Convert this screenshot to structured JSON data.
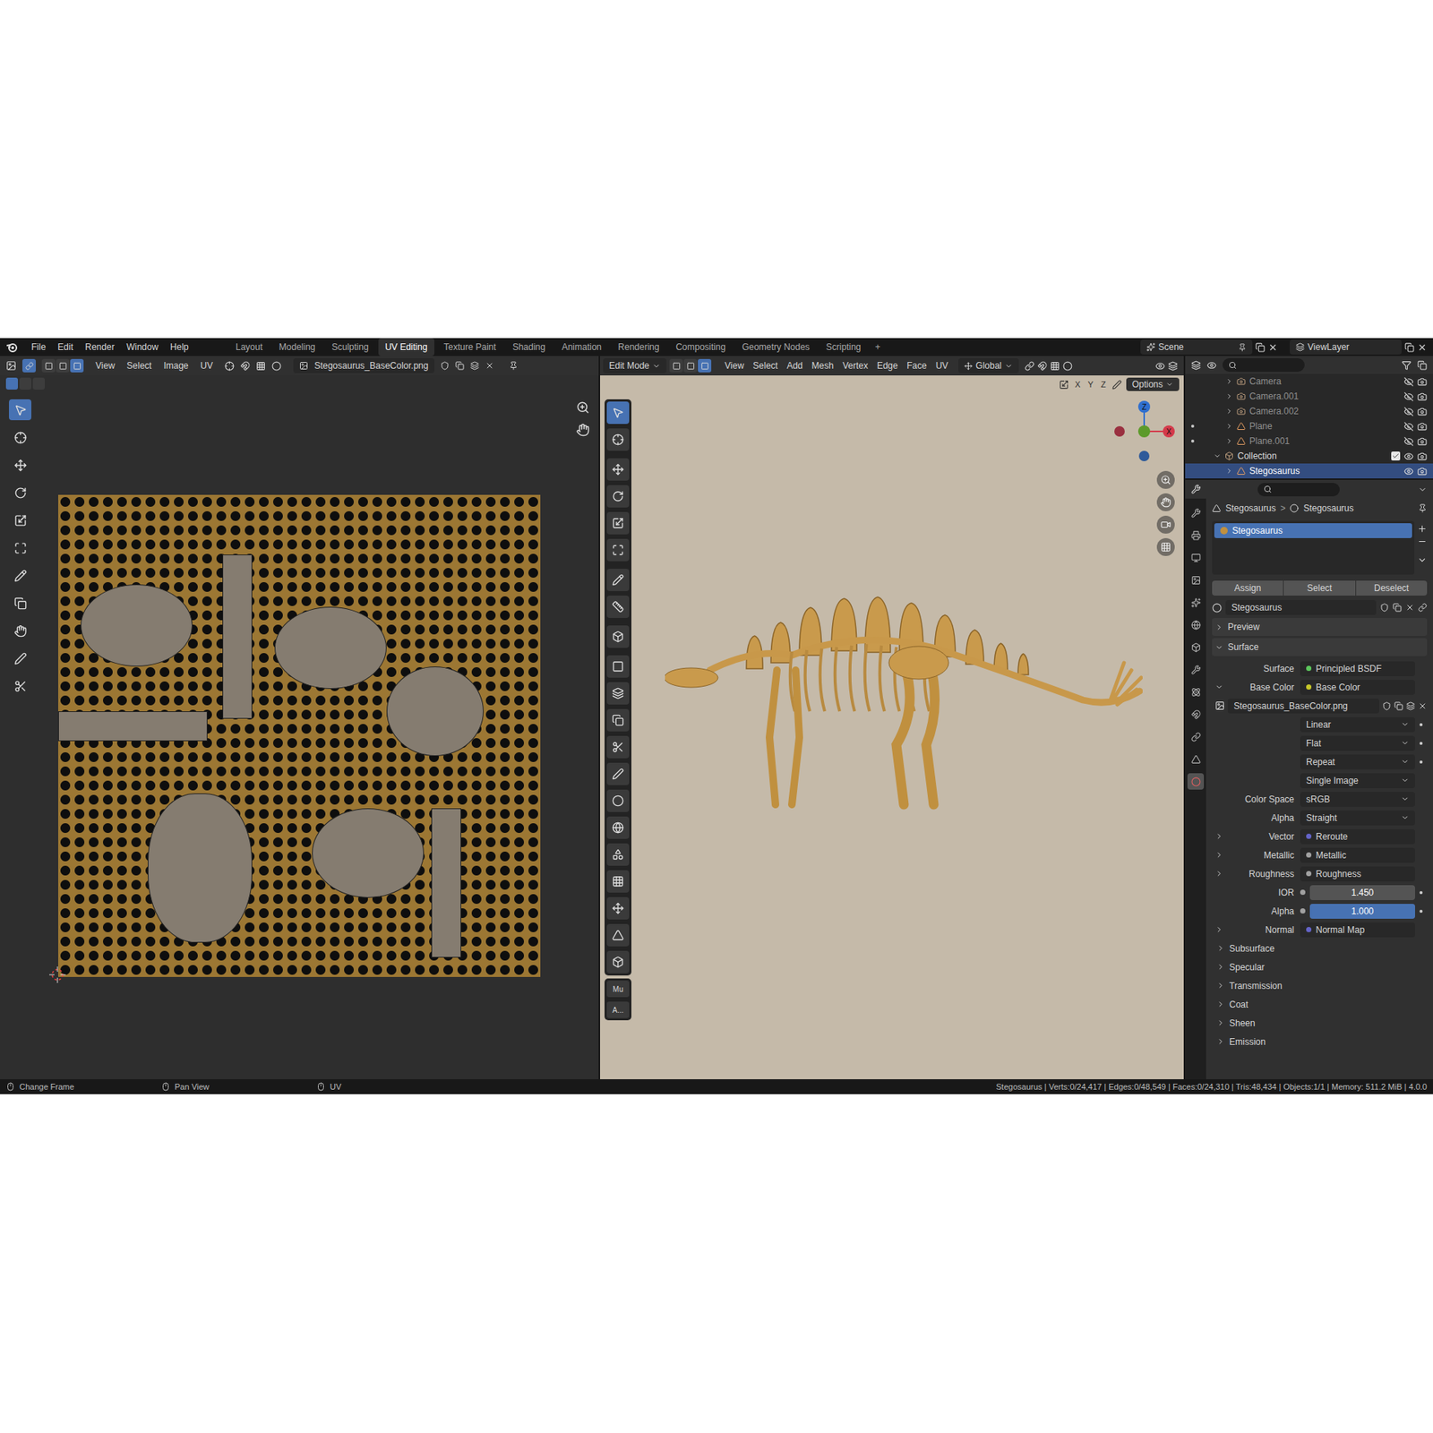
{
  "topbar": {
    "menus": [
      "File",
      "Edit",
      "Render",
      "Window",
      "Help"
    ],
    "workspaces": [
      {
        "label": "Layout",
        "selected": false
      },
      {
        "label": "Modeling",
        "selected": false
      },
      {
        "label": "Sculpting",
        "selected": false
      },
      {
        "label": "UV Editing",
        "selected": true
      },
      {
        "label": "Texture Paint",
        "selected": false
      },
      {
        "label": "Shading",
        "selected": false
      },
      {
        "label": "Animation",
        "selected": false
      },
      {
        "label": "Rendering",
        "selected": false
      },
      {
        "label": "Compositing",
        "selected": false
      },
      {
        "label": "Geometry Nodes",
        "selected": false
      },
      {
        "label": "Scripting",
        "selected": false
      }
    ],
    "add_tab": "+",
    "scene": "Scene",
    "view_layer": "ViewLayer"
  },
  "uv_editor": {
    "menus": [
      "View",
      "Select",
      "Image",
      "UV"
    ],
    "image_name": "Stegosaurus_BaseColor.png",
    "select_modes": [
      {
        "selected": false
      },
      {
        "selected": false
      },
      {
        "selected": true
      }
    ],
    "tools": [
      {
        "selected": true
      },
      {
        "selected": false
      },
      {
        "selected": false
      },
      {
        "selected": false
      },
      {
        "selected": false
      },
      {
        "selected": false
      },
      {
        "selected": false
      },
      {
        "selected": false
      },
      {
        "selected": false
      },
      {
        "selected": false
      },
      {
        "selected": false
      }
    ]
  },
  "viewport": {
    "mode": "Edit Mode",
    "menus": [
      "View",
      "Select",
      "Add",
      "Mesh",
      "Vertex",
      "Edge",
      "Face",
      "UV"
    ],
    "orientation": "Global",
    "select_modes": [
      {
        "selected": false
      },
      {
        "selected": false
      },
      {
        "selected": true
      }
    ],
    "axes": [
      "X",
      "Y",
      "Z"
    ],
    "options": "Options",
    "gizmo": {
      "z": "Z",
      "x": "X"
    },
    "tools": [
      {
        "selected": true
      },
      {
        "selected": false
      },
      {
        "selected": false
      },
      {
        "selected": false
      },
      {
        "selected": false
      },
      {
        "selected": false
      },
      {
        "selected": false
      },
      {
        "selected": false
      },
      {
        "selected": false
      },
      {
        "selected": false
      },
      {
        "selected": false
      },
      {
        "selected": false
      },
      {
        "selected": false
      },
      {
        "selected": false
      },
      {
        "selected": false
      },
      {
        "selected": false
      },
      {
        "selected": false
      },
      {
        "selected": false
      },
      {
        "selected": false
      },
      {
        "selected": false
      },
      {
        "selected": false
      }
    ],
    "side_tabs": [
      "Mu",
      "A..."
    ]
  },
  "outliner": {
    "items": [
      {
        "name": "Camera",
        "kind": "camera",
        "selected": false,
        "dimmed": true,
        "dot": false,
        "expanded": false,
        "visible": false
      },
      {
        "name": "Camera.001",
        "kind": "camera",
        "selected": false,
        "dimmed": true,
        "dot": false,
        "expanded": false,
        "visible": false
      },
      {
        "name": "Camera.002",
        "kind": "camera",
        "selected": false,
        "dimmed": true,
        "dot": false,
        "expanded": false,
        "visible": false
      },
      {
        "name": "Plane",
        "kind": "mesh",
        "selected": false,
        "dimmed": true,
        "dot": true,
        "expanded": false,
        "visible": false
      },
      {
        "name": "Plane.001",
        "kind": "mesh",
        "selected": false,
        "dimmed": true,
        "dot": true,
        "expanded": false,
        "visible": false
      },
      {
        "name": "Collection",
        "kind": "collection",
        "selected": false,
        "dimmed": false,
        "dot": false,
        "expanded": true,
        "visible": true
      },
      {
        "name": "Stegosaurus",
        "kind": "mesh",
        "selected": true,
        "dimmed": false,
        "dot": false,
        "expanded": false,
        "visible": true
      }
    ]
  },
  "properties": {
    "tabs": [
      {
        "selected": false
      },
      {
        "selected": false
      },
      {
        "selected": false
      },
      {
        "selected": false
      },
      {
        "selected": false
      },
      {
        "selected": false
      },
      {
        "selected": false
      },
      {
        "selected": false
      },
      {
        "selected": false
      },
      {
        "selected": false
      },
      {
        "selected": false
      },
      {
        "selected": false
      },
      {
        "selected": true
      }
    ],
    "breadcrumb": [
      "Stegosaurus",
      "Stegosaurus"
    ],
    "breadcrumb_separator": ">",
    "slots": [
      {
        "name": "Stegosaurus",
        "selected": true
      }
    ],
    "slot_buttons": [
      "Assign",
      "Select",
      "Deselect"
    ],
    "material": "Stegosaurus",
    "panels": [
      {
        "label": "Preview",
        "expanded": false
      },
      {
        "label": "Surface",
        "expanded": true
      }
    ],
    "rows": [
      {
        "kind": "link",
        "label": "Surface",
        "value": "Principled BSDF",
        "socket": "#5cc75c",
        "expandable": false,
        "expanded": false,
        "keyframe": false
      },
      {
        "kind": "link",
        "label": "Base Color",
        "value": "Base Color",
        "socket": "#c7c729",
        "expandable": true,
        "expanded": true,
        "keyframe": false
      },
      {
        "kind": "image",
        "value": "Stegosaurus_BaseColor.png"
      },
      {
        "kind": "enum",
        "label": "",
        "value": "Linear",
        "keyframe": true
      },
      {
        "kind": "enum",
        "label": "",
        "value": "Flat",
        "keyframe": true
      },
      {
        "kind": "enum",
        "label": "",
        "value": "Repeat",
        "keyframe": true
      },
      {
        "kind": "enum",
        "label": "",
        "value": "Single Image",
        "keyframe": false
      },
      {
        "kind": "enum",
        "label": "Color Space",
        "value": "sRGB",
        "keyframe": false
      },
      {
        "kind": "enum",
        "label": "Alpha",
        "value": "Straight",
        "keyframe": false
      },
      {
        "kind": "link",
        "label": "Vector",
        "value": "Reroute",
        "socket": "#6363c7",
        "expandable": true,
        "expanded": false,
        "keyframe": false
      },
      {
        "kind": "link",
        "label": "Metallic",
        "value": "Metallic",
        "socket": "#a1a1a1",
        "expandable": true,
        "expanded": false,
        "keyframe": false
      },
      {
        "kind": "link",
        "label": "Roughness",
        "value": "Roughness",
        "socket": "#a1a1a1",
        "expandable": true,
        "expanded": false,
        "keyframe": false
      },
      {
        "kind": "number",
        "label": "IOR",
        "value": "1.450",
        "level": 0,
        "socket": "#a1a1a1",
        "keyframe": true
      },
      {
        "kind": "number",
        "label": "Alpha",
        "value": "1.000",
        "level": 1,
        "socket": "#a1a1a1",
        "keyframe": true
      },
      {
        "kind": "link",
        "label": "Normal",
        "value": "Normal Map",
        "socket": "#6363c7",
        "expandable": true,
        "expanded": false,
        "keyframe": false
      },
      {
        "kind": "subpanel",
        "label": "Subsurface",
        "expanded": false
      },
      {
        "kind": "subpanel",
        "label": "Specular",
        "expanded": false
      },
      {
        "kind": "subpanel",
        "label": "Transmission",
        "expanded": false
      },
      {
        "kind": "subpanel",
        "label": "Coat",
        "expanded": false
      },
      {
        "kind": "subpanel",
        "label": "Sheen",
        "expanded": false
      },
      {
        "kind": "subpanel",
        "label": "Emission",
        "expanded": false
      }
    ]
  },
  "status_bar": {
    "hints": [
      "Change Frame",
      "Pan View",
      "UV"
    ],
    "stats": "Stegosaurus | Verts:0/24,417 | Edges:0/48,549 | Faces:0/24,310 | Tris:48,434 | Objects:1/1 | Memory: 511.2 MiB | 4.0.0"
  }
}
